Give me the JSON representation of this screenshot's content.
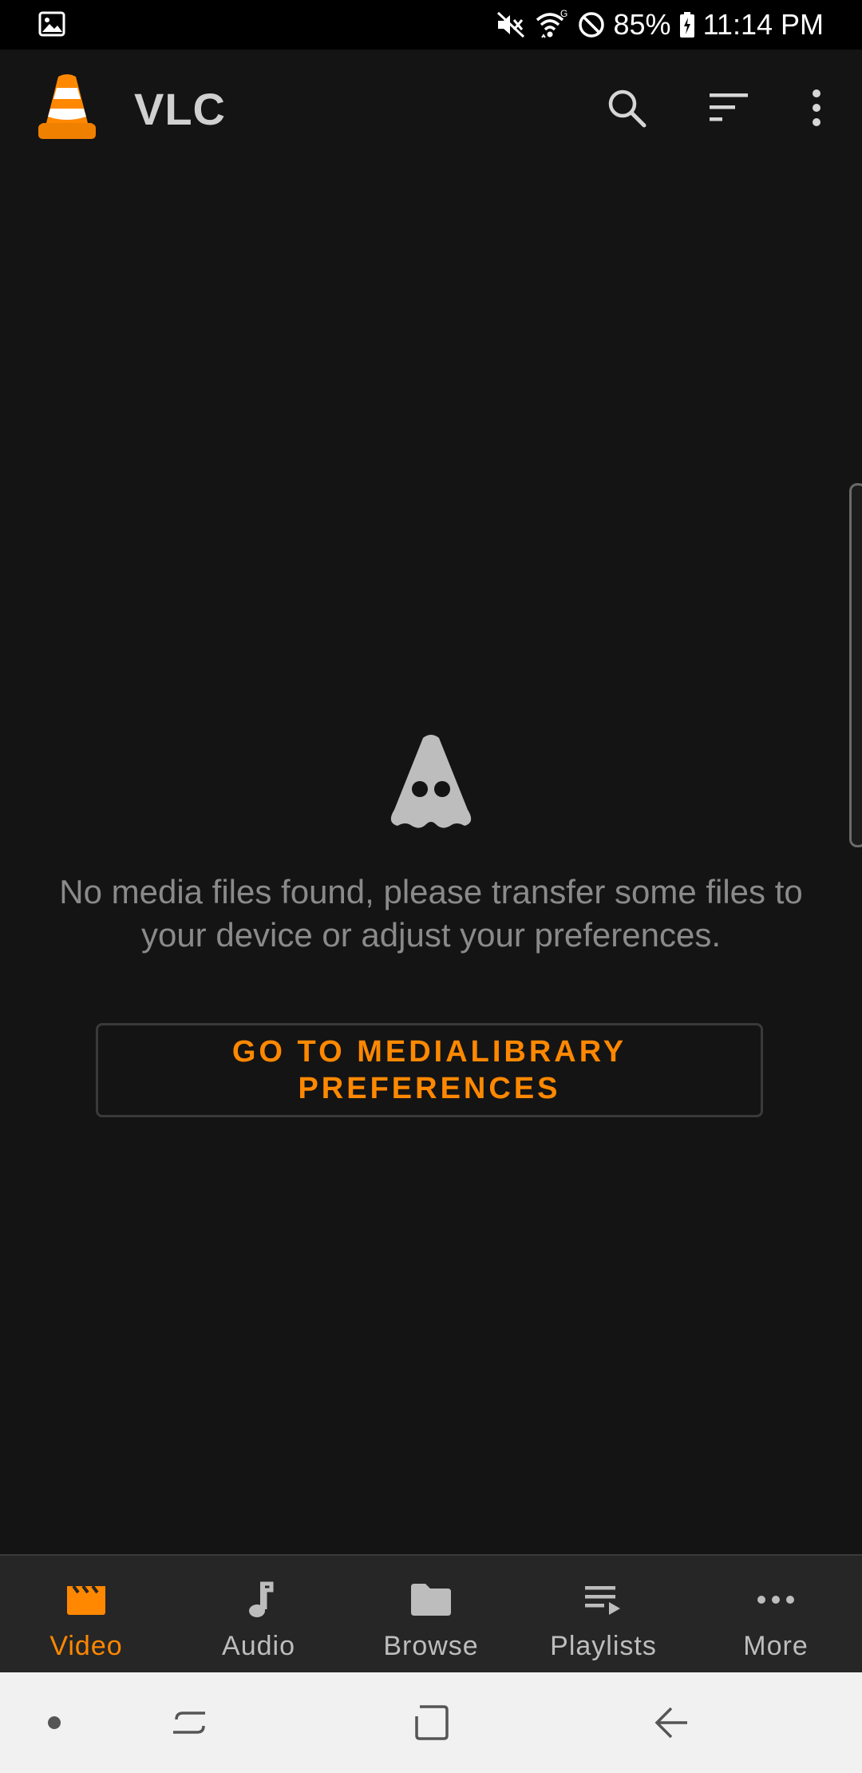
{
  "status_bar": {
    "battery": "85%",
    "time": "11:14 PM",
    "icons": [
      "gallery-icon",
      "mute-icon",
      "wifi-icon",
      "do-not-disturb-icon",
      "battery-charging-icon"
    ]
  },
  "app_bar": {
    "title": "VLC",
    "actions": [
      "search-icon",
      "sort-icon",
      "more-vert-icon"
    ]
  },
  "empty_state": {
    "message": "No media files found, please transfer some files to your device or adjust your preferences.",
    "button_label_line1": "GO TO MEDIALIBRARY",
    "button_label_line2": "PREFERENCES"
  },
  "bottom_nav": {
    "items": [
      {
        "label": "Video",
        "icon": "video-clapper-icon",
        "active": true
      },
      {
        "label": "Audio",
        "icon": "music-note-icon",
        "active": false
      },
      {
        "label": "Browse",
        "icon": "folder-icon",
        "active": false
      },
      {
        "label": "Playlists",
        "icon": "playlist-icon",
        "active": false
      },
      {
        "label": "More",
        "icon": "more-horiz-icon",
        "active": false
      }
    ]
  },
  "system_nav": {
    "buttons": [
      "dot-indicator",
      "recents-icon",
      "home-icon",
      "back-icon"
    ]
  },
  "colors": {
    "accent": "#ff8800",
    "background": "#141414",
    "nav_background": "#262626",
    "system_nav_background": "#f1f1f1"
  }
}
